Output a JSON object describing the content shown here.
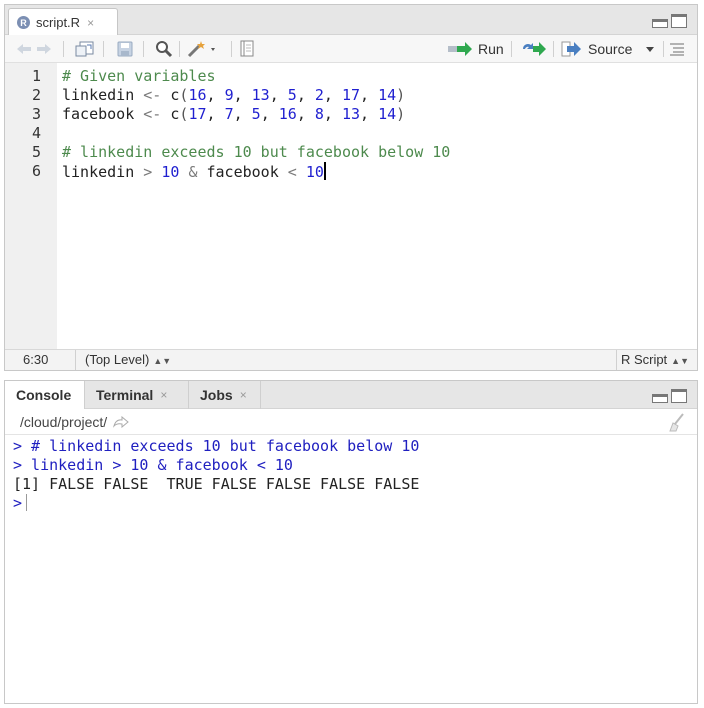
{
  "editor": {
    "tab": {
      "filename": "script.R",
      "badge": "R",
      "close": "×"
    },
    "toolbar": {
      "run_label": "Run",
      "source_label": "Source"
    },
    "line_numbers": [
      "1",
      "2",
      "3",
      "4",
      "5",
      "6"
    ],
    "code": {
      "line1": "# Given variables",
      "line2": {
        "name": "linkedin",
        "assign": "<-",
        "fn": "c",
        "nums": [
          "16",
          "9",
          "13",
          "5",
          "2",
          "17",
          "14"
        ]
      },
      "line3": {
        "name": "facebook",
        "assign": "<-",
        "fn": "c",
        "nums": [
          "17",
          "7",
          "5",
          "16",
          "8",
          "13",
          "14"
        ]
      },
      "line5": "# linkedin exceeds 10 but facebook below 10",
      "line6": {
        "a": "linkedin",
        "gt": ">",
        "n1": "10",
        "and": "&",
        "b": "facebook",
        "lt": "<",
        "n2": "10"
      }
    },
    "status": {
      "position": "6:30",
      "scope": "(Top Level)",
      "file_type": "R Script"
    }
  },
  "console": {
    "tabs": [
      {
        "label": "Console",
        "close": ""
      },
      {
        "label": "Terminal",
        "close": "×"
      },
      {
        "label": "Jobs",
        "close": "×"
      }
    ],
    "path": "/cloud/project/",
    "lines": [
      "> # linkedin exceeds 10 but facebook below 10",
      "> linkedin > 10 & facebook < 10",
      "[1] FALSE FALSE  TRUE FALSE FALSE FALSE FALSE",
      ">"
    ]
  },
  "colors": {
    "comment": "#4d8a4d",
    "number": "#1f1fd0",
    "console_input": "#2020c0",
    "run_arrow": "#2fa84f",
    "source_arrow": "#4a7fc1"
  },
  "icons": [
    "back-arrow-icon",
    "forward-arrow-icon",
    "show-in-window-icon",
    "save-icon",
    "search-icon",
    "magic-wand-icon",
    "compile-notebook-icon",
    "run-icon",
    "rerun-icon",
    "source-icon",
    "outline-icon",
    "go-to-directory-icon",
    "clear-console-icon"
  ]
}
